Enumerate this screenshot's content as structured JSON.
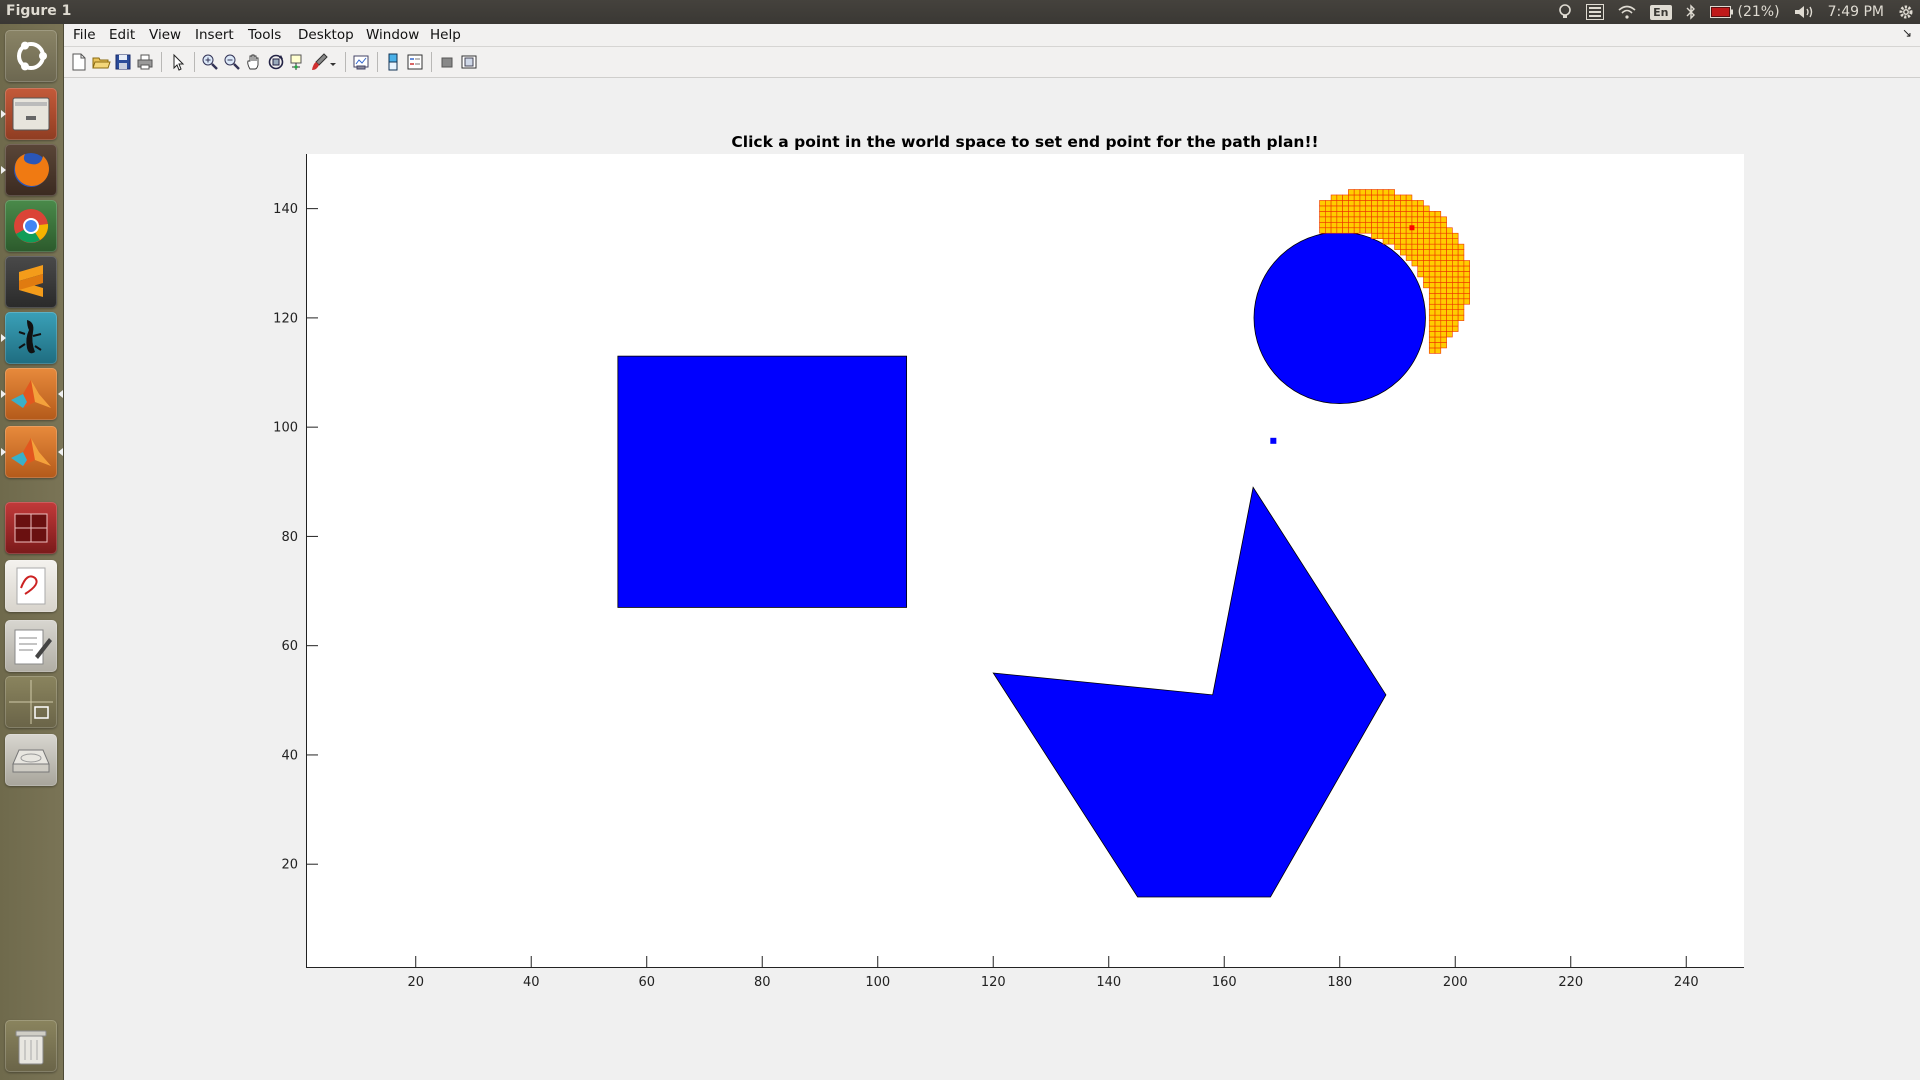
{
  "top_panel": {
    "window_title": "Figure 1",
    "language": "En",
    "battery": "(21%)",
    "clock": "7:49 PM"
  },
  "launcher": {
    "items": [
      "ubuntu-dash",
      "files",
      "firefox",
      "chrome",
      "sublime-text",
      "terminal-gecko",
      "matlab",
      "matlab",
      "workspace-red",
      "pdf-viewer",
      "text-editor",
      "workspace-switcher",
      "disk",
      "trash"
    ]
  },
  "menubar": {
    "items": [
      {
        "label": "File"
      },
      {
        "label": "Edit"
      },
      {
        "label": "View"
      },
      {
        "label": "Insert"
      },
      {
        "label": "Tools"
      },
      {
        "label": "Desktop"
      },
      {
        "label": "Window"
      },
      {
        "label": "Help"
      }
    ]
  },
  "toolbar": {
    "icons": [
      "new-figure",
      "open-file",
      "save",
      "print",
      "edit-plot",
      "zoom-in",
      "zoom-out",
      "pan",
      "rotate-3d",
      "data-cursor",
      "brush",
      "link-plot",
      "insert-colorbar",
      "insert-legend",
      "hide-plot-tools",
      "show-plot-tools"
    ]
  },
  "chart_data": {
    "type": "scatter",
    "title": "Click a point in the world space to set end point for the path plan!!",
    "xlim": [
      1,
      250
    ],
    "ylim": [
      1,
      150
    ],
    "xticks": [
      20,
      40,
      60,
      80,
      100,
      120,
      140,
      160,
      180,
      200,
      220,
      240
    ],
    "yticks": [
      20,
      40,
      60,
      80,
      100,
      120,
      140
    ],
    "grid": false,
    "obstacle_color": "#0000ff",
    "obstacles": [
      {
        "shape": "rectangle",
        "x": [
          55,
          105
        ],
        "y": [
          67,
          113
        ]
      },
      {
        "shape": "circle",
        "center": [
          180,
          120
        ],
        "radius": 15
      },
      {
        "shape": "polygon",
        "points": [
          [
            120,
            55
          ],
          [
            158,
            51
          ],
          [
            165,
            89
          ],
          [
            188,
            51
          ],
          [
            168,
            14
          ],
          [
            145,
            14
          ]
        ]
      }
    ],
    "start_point": {
      "x": 168.5,
      "y": 97.5,
      "color": "#0000ff"
    },
    "explored_cells": {
      "fill": "#ffcc00",
      "edge": "#ee3300"
    },
    "current_point": {
      "x": 192.5,
      "y": 136.5,
      "color": "#ff0000"
    }
  }
}
